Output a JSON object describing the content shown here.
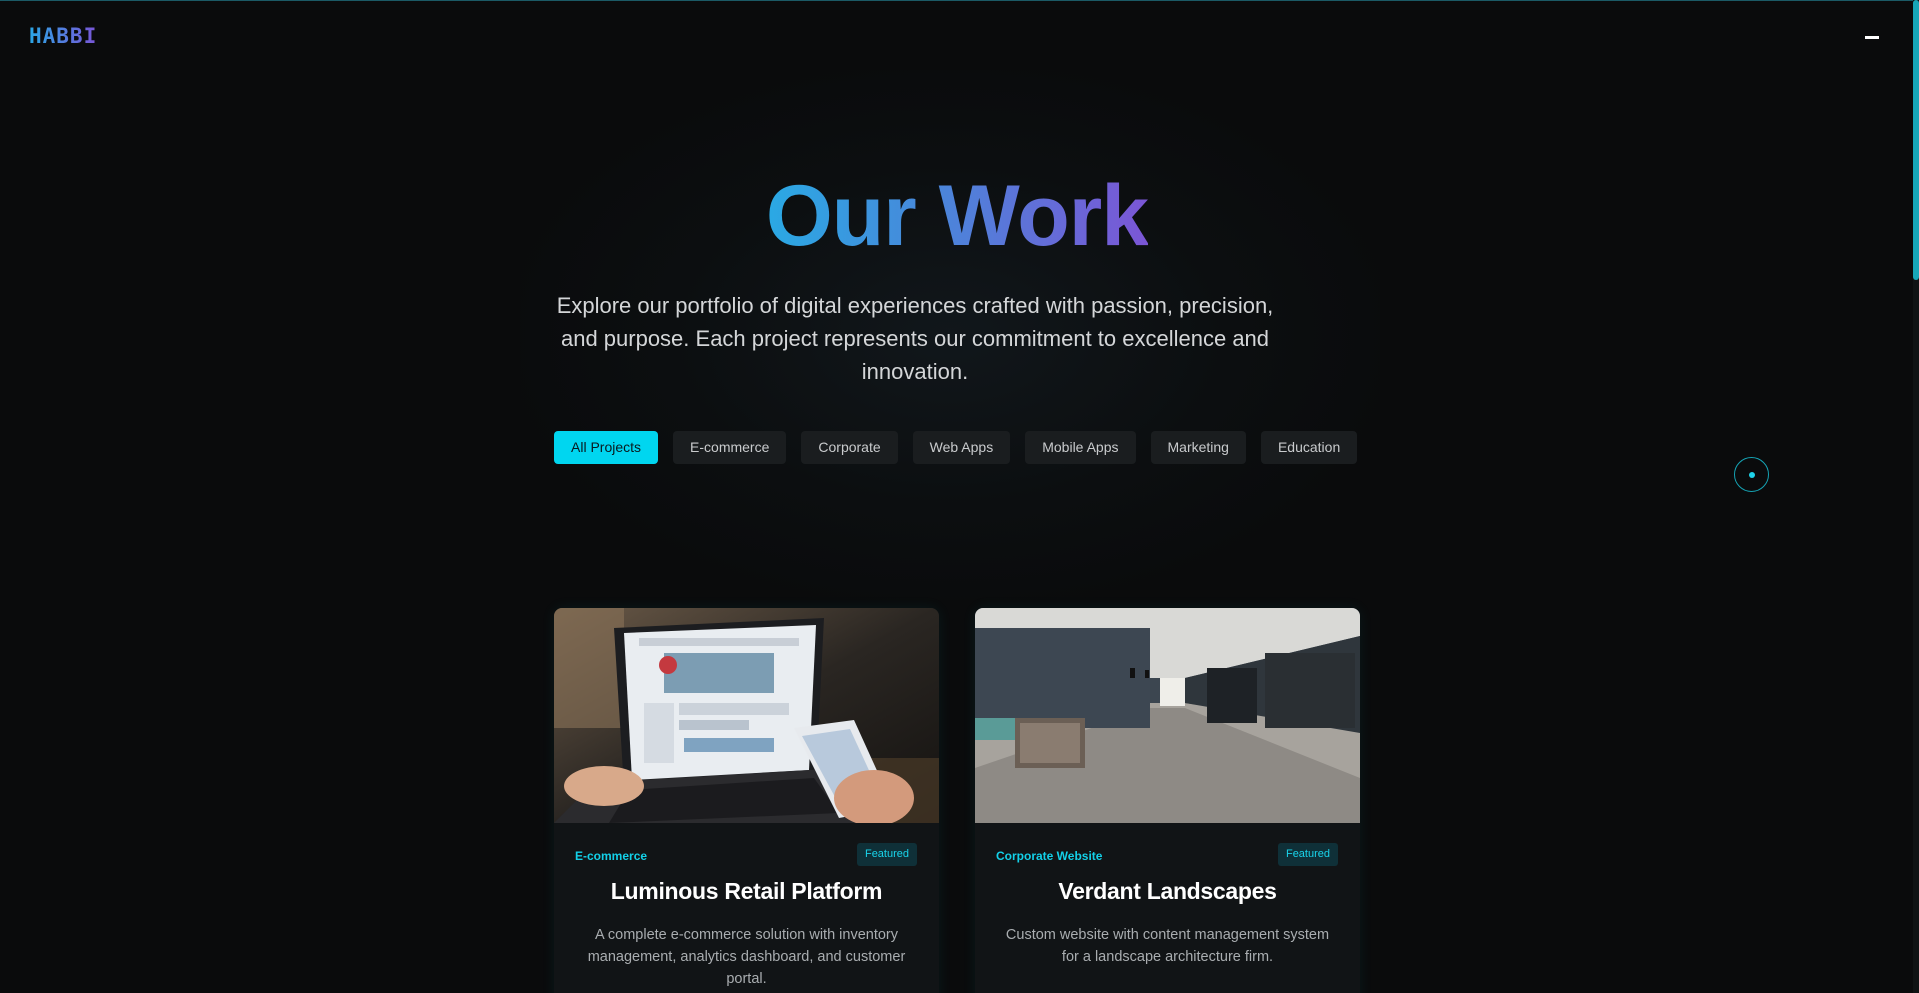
{
  "brand": {
    "logo": "HABBI"
  },
  "header": {
    "menu_icon": "menu-icon"
  },
  "hero": {
    "title": "Our Work",
    "subtitle": "Explore our portfolio of digital experiences crafted with passion, precision, and purpose. Each project represents our commitment to excellence and innovation."
  },
  "filters": [
    {
      "label": "All Projects",
      "active": true
    },
    {
      "label": "E-commerce",
      "active": false
    },
    {
      "label": "Corporate",
      "active": false
    },
    {
      "label": "Web Apps",
      "active": false
    },
    {
      "label": "Mobile Apps",
      "active": false
    },
    {
      "label": "Marketing",
      "active": false
    },
    {
      "label": "Education",
      "active": false
    }
  ],
  "projects": [
    {
      "category": "E-commerce",
      "badge": "Featured",
      "title": "Luminous Retail Platform",
      "description": "A complete e-commerce solution with inventory management, analytics dashboard, and customer portal."
    },
    {
      "category": "Corporate Website",
      "badge": "Featured",
      "title": "Verdant Landscapes",
      "description": "Custom website with content management system for a landscape architecture firm."
    }
  ],
  "colors": {
    "accent": "#00d6f0",
    "background": "#0a0b0c",
    "gradient_start": "#2aa9e4",
    "gradient_end": "#7b56d6"
  }
}
